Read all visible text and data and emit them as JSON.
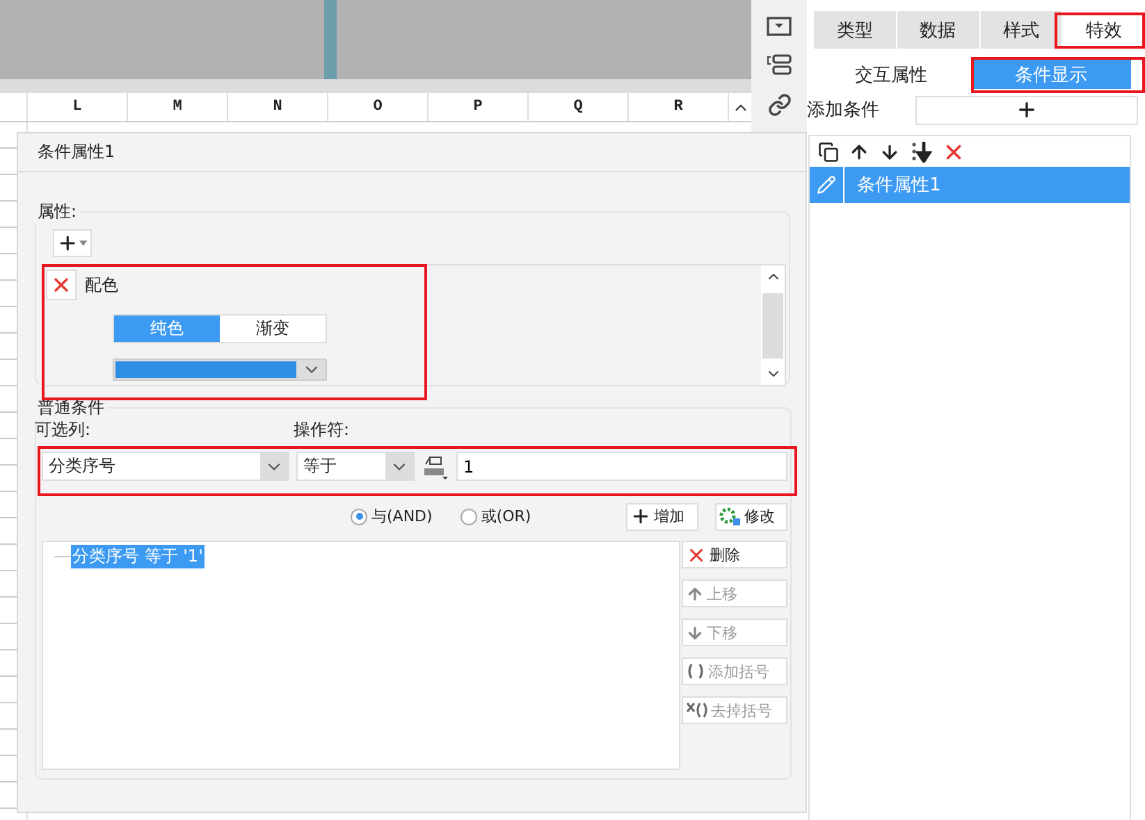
{
  "sheet": {
    "columns": [
      "L",
      "M",
      "N",
      "O",
      "P",
      "Q",
      "R"
    ]
  },
  "side_panel": {
    "tabs": [
      {
        "label": "类型",
        "selected": false
      },
      {
        "label": "数据",
        "selected": false
      },
      {
        "label": "样式",
        "selected": false
      },
      {
        "label": "特效",
        "selected": true
      }
    ],
    "subtabs": [
      {
        "label": "交互属性",
        "selected": false
      },
      {
        "label": "条件显示",
        "selected": true
      }
    ],
    "add_label": "添加条件",
    "conditions": [
      {
        "label": "条件属性1",
        "selected": true
      }
    ]
  },
  "dialog": {
    "title": "条件属性1",
    "properties": {
      "legend": "属性:",
      "items": [
        {
          "kind": "color",
          "label": "配色",
          "modes": [
            {
              "label": "纯色",
              "selected": true
            },
            {
              "label": "渐变",
              "selected": false
            }
          ],
          "color": "#2e8de4"
        }
      ]
    },
    "conditions": {
      "legend": "普通条件",
      "column_label": "可选列:",
      "column_value": "分类序号",
      "operator_label": "操作符:",
      "operator_value": "等于",
      "value": "1",
      "logic": [
        {
          "label": "与(AND)",
          "selected": true
        },
        {
          "label": "或(OR)",
          "selected": false
        }
      ],
      "add_button": "增加",
      "edit_button": "修改",
      "items": [
        {
          "text": "分类序号 等于 '1'",
          "selected": true
        }
      ],
      "actions": [
        {
          "kind": "delete",
          "label": "删除",
          "disabled": false
        },
        {
          "kind": "up",
          "label": "上移",
          "disabled": true
        },
        {
          "kind": "down",
          "label": "下移",
          "disabled": true
        },
        {
          "kind": "add-paren",
          "label": "添加括号",
          "disabled": true
        },
        {
          "kind": "remove-paren",
          "label": "去掉括号",
          "disabled": true
        }
      ]
    }
  }
}
